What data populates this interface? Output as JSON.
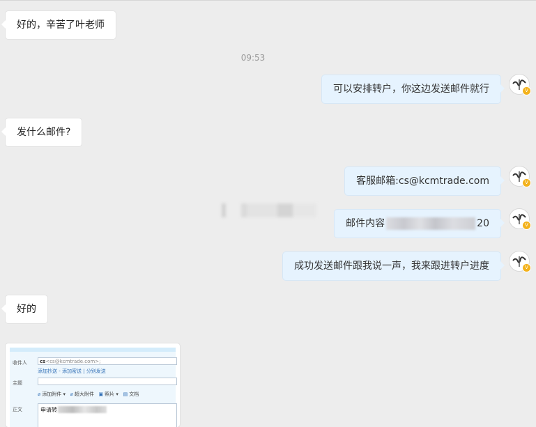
{
  "chat": {
    "msg1": "好的，辛苦了叶老师",
    "time1": "09:53",
    "msg2": "可以安排转户，你这边发送邮件就行",
    "msg3": "发什么邮件?",
    "msg4": "客服邮箱:cs@kcmtrade.com",
    "msg5_prefix": "邮件内容",
    "msg5_suffix": "20",
    "msg6": "成功发送邮件跟我说一声，我来跟进转户进度",
    "msg7": "好的"
  },
  "email_screenshot": {
    "to_label": "收件人",
    "to_bold": "cs",
    "to_value": "<cs@kcmtrade.com>;",
    "cc_links": "添加抄送 - 添加密送 | 分别发送",
    "subject_label": "主题",
    "toolbar": [
      "添加附件",
      "超大附件",
      "照片",
      "文档"
    ],
    "body_label": "正文",
    "body_text": "申请转"
  },
  "colors": {
    "background": "#ededed",
    "left_bubble": "#ffffff",
    "right_bubble": "#e6f3fe",
    "timestamp": "#999999",
    "badge": "#f3b21c"
  },
  "icons": {
    "avatar": "calligraphy-avatar-icon",
    "badge": "v-badge-icon"
  }
}
